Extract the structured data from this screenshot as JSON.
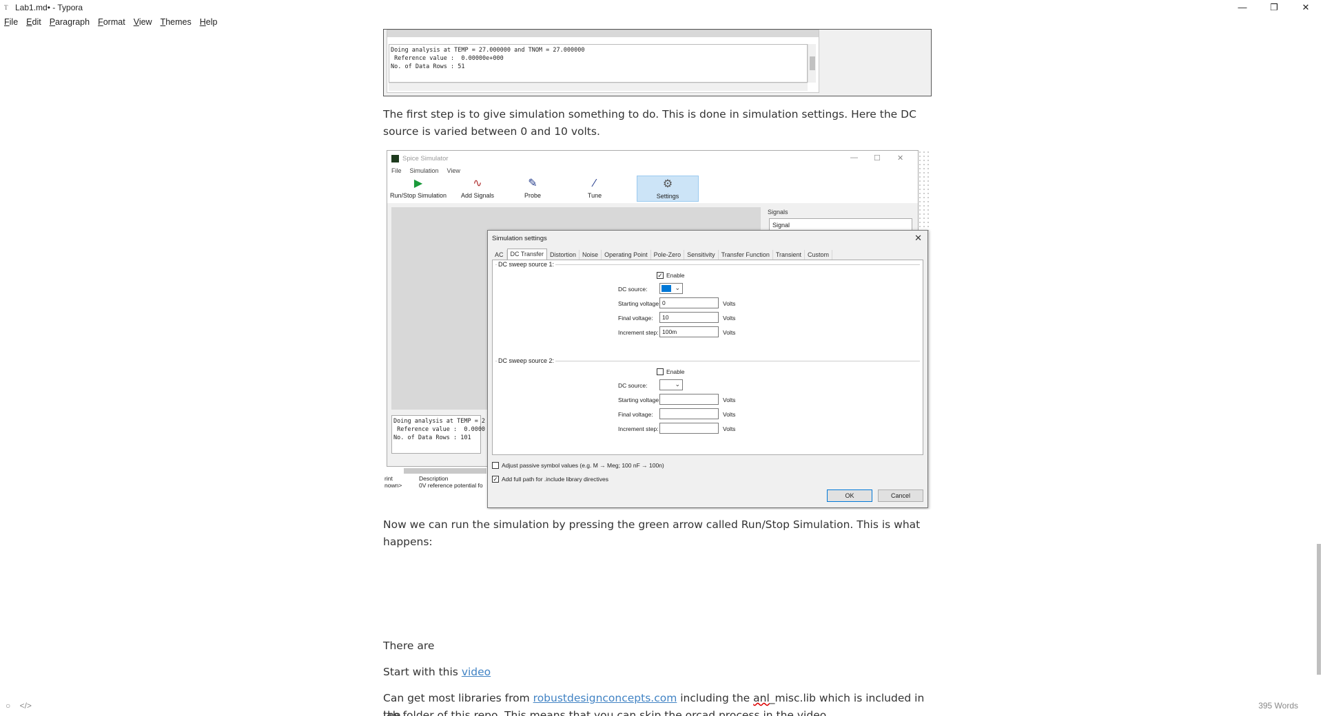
{
  "window": {
    "title": "Lab1.md• - Typora",
    "app_icon": "T",
    "minimize": "—",
    "maximize": "❐",
    "close": "✕"
  },
  "menu": [
    "File",
    "Edit",
    "Paragraph",
    "Format",
    "View",
    "Themes",
    "Help"
  ],
  "shot1": {
    "log": "Doing analysis at TEMP = 27.000000 and TNOM = 27.000000\n Reference value :  0.00000e+000\nNo. of Data Rows : 51"
  },
  "paragraphs": {
    "p1": "The first step is to give simulation something to do. This is done in simulation settings. Here the DC source is varied between 0 and 10 volts.",
    "p2": "Now we can run the simulation by pressing the green arrow called Run/Stop Simulation. This is what happens:",
    "p3": "There are",
    "p4_prefix": "Start with this ",
    "p4_link": "video",
    "p5_prefix": "Can get most libraries from ",
    "p5_link": "robustdesignconcepts.com",
    "p5_mid": " including the ",
    "p5_squiggle": "anl",
    "p5_suffix": "_misc.lib which is included in the",
    "p6": "lab folder of this repo. This means that you can skip the orcad process in the video."
  },
  "spice": {
    "title": "Spice Simulator",
    "menu": [
      "File",
      "Simulation",
      "View"
    ],
    "tools": [
      {
        "label": "Run/Stop Simulation",
        "icon": "▶"
      },
      {
        "label": "Add Signals",
        "icon": "∿"
      },
      {
        "label": "Probe",
        "icon": "✎"
      },
      {
        "label": "Tune",
        "icon": "⁄"
      },
      {
        "label": "Settings",
        "icon": "⚙"
      }
    ],
    "signals_label": "Signals",
    "signals_header": "Signal",
    "log": "Doing analysis at TEMP = 2\n Reference value :  0.0000\nNo. of Data Rows : 101",
    "bottom_col1": "rint",
    "bottom_col1b": "nown>",
    "bottom_col2": "Description",
    "bottom_col2b": "0V reference potential fo"
  },
  "dialog": {
    "title": "Simulation settings",
    "tabs": [
      "AC",
      "DC Transfer",
      "Distortion",
      "Noise",
      "Operating Point",
      "Pole-Zero",
      "Sensitivity",
      "Transfer Function",
      "Transient",
      "Custom"
    ],
    "source1": {
      "group": "DC sweep source 1:",
      "enable": "Enable",
      "dc_source_label": "DC source:",
      "start_label": "Starting voltage:",
      "start_value": "0",
      "final_label": "Final voltage:",
      "final_value": "10",
      "step_label": "Increment step:",
      "step_value": "100m",
      "units": "Volts"
    },
    "source2": {
      "group": "DC sweep source 2:",
      "enable": "Enable",
      "dc_source_label": "DC source:",
      "start_label": "Starting voltage:",
      "final_label": "Final voltage:",
      "step_label": "Increment step:",
      "units": "Volts"
    },
    "adjust_passive": "Adjust passive symbol values (e.g. M → Meg; 100 nF → 100n)",
    "full_path": "Add full path for .include library directives",
    "ok": "OK",
    "cancel": "Cancel"
  },
  "status": {
    "word_count": "395 Words",
    "circle_icon": "○",
    "code_icon": "</>"
  }
}
